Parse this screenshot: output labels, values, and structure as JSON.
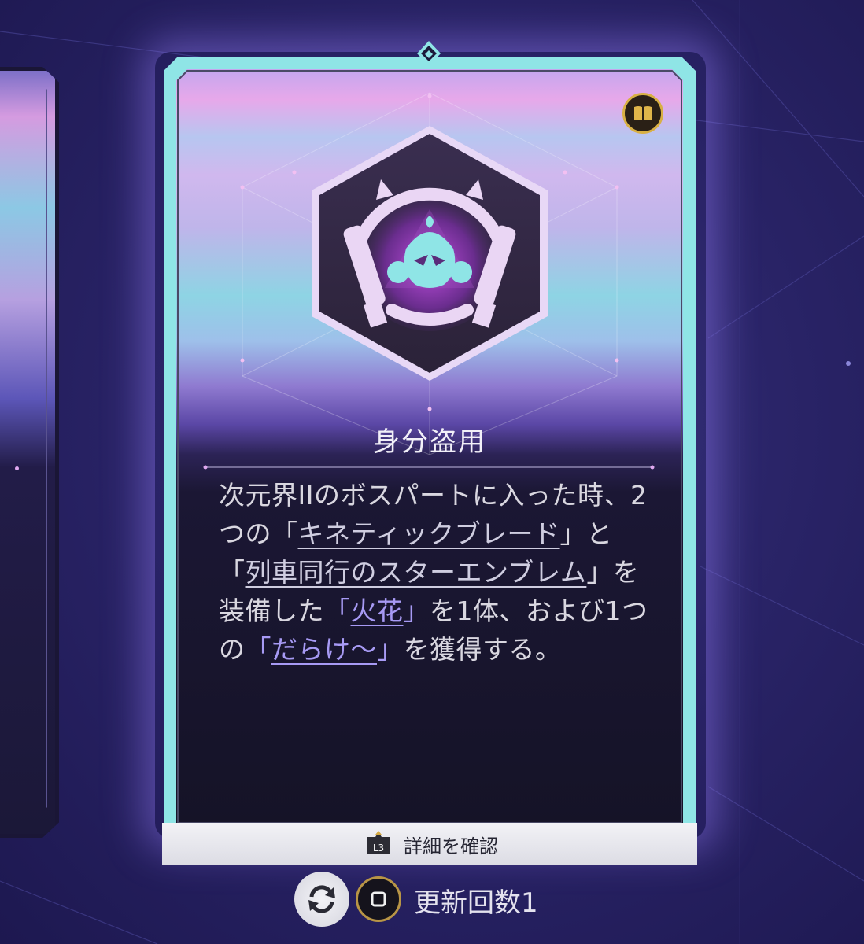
{
  "card": {
    "title": "身分盗用",
    "description": {
      "p1": "次元界IIのボスパートに入った時、2つの",
      "q1": "「",
      "link1": "キネティックブレード",
      "q1e": "」",
      "and": "と",
      "q2": "「",
      "link2": "列車同行のスターエンブレム",
      "q2e": "」",
      "p2": "を装備した",
      "q3": "「",
      "link3": "火花",
      "q3e": "」",
      "p3": "を1体、および1つの",
      "q4": "「",
      "link4": "だらけ〜",
      "q4e": "」",
      "p4": "を獲得する。"
    },
    "emblem_icon": "spark-mask-bat-icon",
    "book_icon": "book-icon"
  },
  "detail_button": {
    "key_label": "L3",
    "label": "詳細を確認"
  },
  "refresh": {
    "icon": "refresh-icon",
    "button_icon": "square-button-icon",
    "label": "更新回数1"
  },
  "colors": {
    "card_border": "#8fe5e6",
    "link_purple": "#a79af4",
    "background": "#2a2468"
  }
}
